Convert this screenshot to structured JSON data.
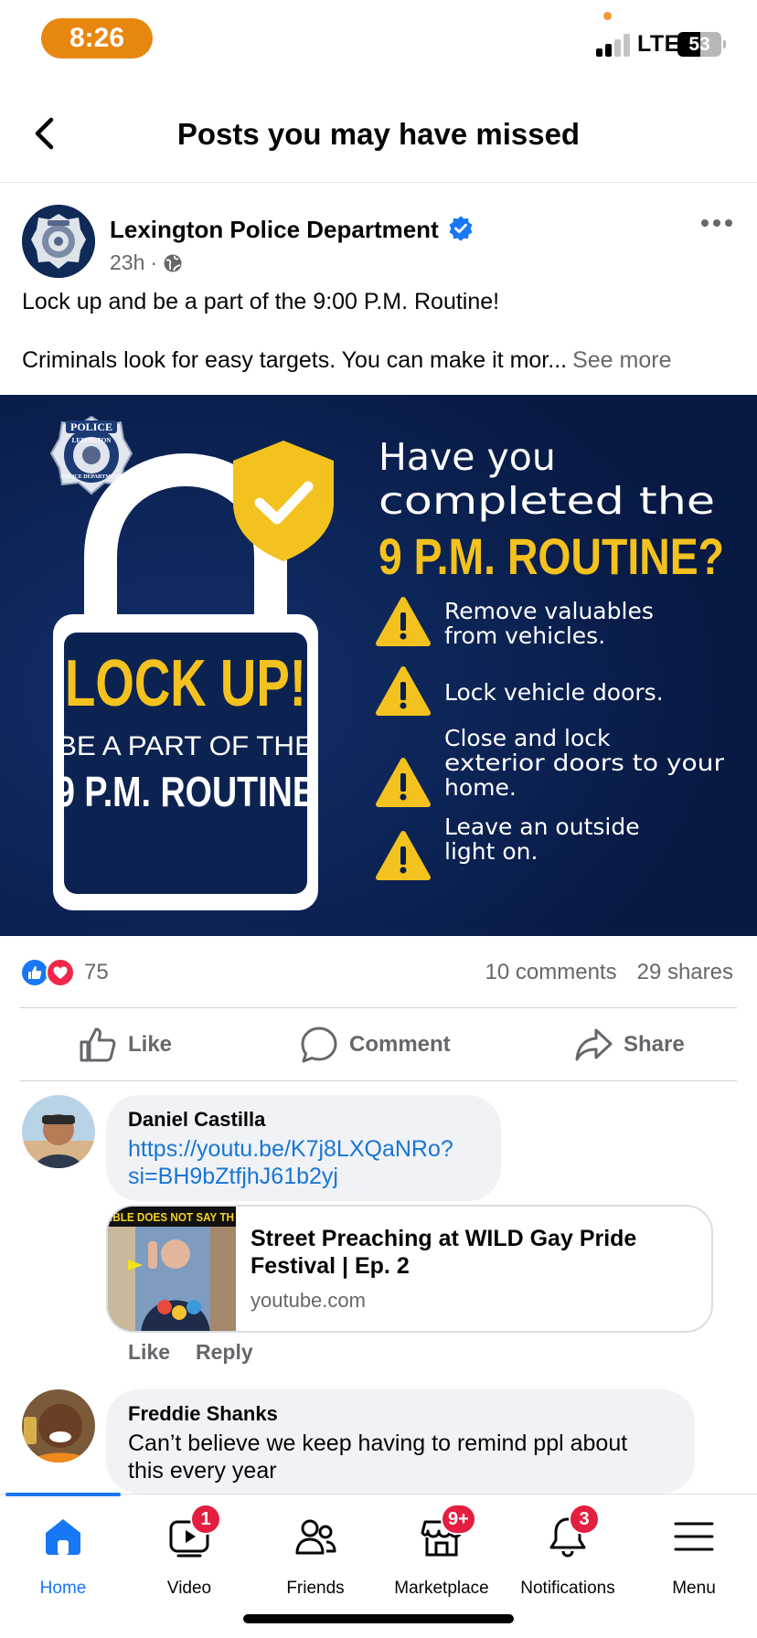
{
  "status_bar": {
    "time": "8:26",
    "network": "LTE",
    "battery": "53",
    "battery_level": 0.53
  },
  "header": {
    "title": "Posts you may have missed"
  },
  "post": {
    "author": "Lexington Police Department",
    "time": "23h",
    "separator": "·",
    "text_line1": "Lock up and be a part of the 9:00 P.M. Routine!",
    "text_line2": "Criminals look for easy targets. You can make it mor...",
    "see_more": "See more",
    "image": {
      "badge_line1": "POLICE",
      "badge_line2": "LEXINGTON",
      "badge_line3": "POLICE DEPARTMENT",
      "lock_up": "LOCK UP!",
      "be_part": "BE A PART OF THE",
      "routine": "9 P.M. ROUTINE",
      "question_line1": "Have you",
      "question_line2": "completed the",
      "question_line3": "9 P.M. ROUTINE?",
      "tips": [
        {
          "line1": "Remove valuables",
          "line2": "from vehicles.",
          "line3": ""
        },
        {
          "line1": "Lock vehicle doors.",
          "line2": "",
          "line3": ""
        },
        {
          "line1": "Close and lock",
          "line2": "exterior doors to your",
          "line3": "home."
        },
        {
          "line1": "Leave an outside",
          "line2": "light on.",
          "line3": ""
        }
      ]
    },
    "reaction_count": "75",
    "comments_count": "10 comments",
    "shares_count": "29 shares",
    "actions": {
      "like": "Like",
      "comment": "Comment",
      "share": "Share"
    }
  },
  "comments": [
    {
      "name": "Daniel Castilla",
      "link_line1": "https://youtu.be/K7j8LXQaNRo?",
      "link_line2": "si=BH9bZtfjhJ61b2yj",
      "preview": {
        "thumb_text": "IBLE DOES NOT SAY TH",
        "title": "Street Preaching at WILD Gay Pride Festival | Ep. 2",
        "domain": "youtube.com"
      },
      "like": "Like",
      "reply": "Reply"
    },
    {
      "name": "Freddie Shanks",
      "text_line1": "Can’t believe we keep having to remind ppl about",
      "text_line2": "this every year"
    }
  ],
  "tabbar": {
    "tabs": [
      {
        "label": "Home",
        "badge": ""
      },
      {
        "label": "Video",
        "badge": "1"
      },
      {
        "label": "Friends",
        "badge": ""
      },
      {
        "label": "Marketplace",
        "badge": "9+"
      },
      {
        "label": "Notifications",
        "badge": "3"
      },
      {
        "label": "Menu",
        "badge": ""
      }
    ]
  },
  "colors": {
    "accent": "#1877f2",
    "poster_navy": "#0a1e4b",
    "poster_gold": "#f4c21e",
    "badge_red": "#e41e3f",
    "time_pill": "#e8870f"
  }
}
